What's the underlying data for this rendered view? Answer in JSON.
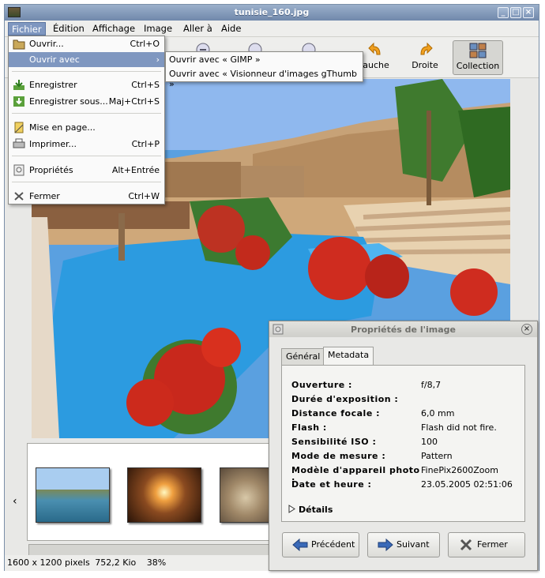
{
  "window": {
    "title": "tunisie_160.jpg",
    "buttons": [
      "_",
      "□",
      "×"
    ]
  },
  "menubar": [
    "Fichier",
    "Édition",
    "Affichage",
    "Image",
    "Aller à",
    "Aide"
  ],
  "toolbar": {
    "gauche": "auche",
    "droite": "Droite",
    "collection": "Collection"
  },
  "file_menu": {
    "open": {
      "label": "Ouvrir...",
      "accel": "Ctrl+O"
    },
    "open_with": {
      "label": "Ouvrir avec",
      "arrow": "›"
    },
    "save": {
      "label": "Enregistrer",
      "accel": "Ctrl+S"
    },
    "save_as": {
      "label": "Enregistrer sous...",
      "accel": "Maj+Ctrl+S"
    },
    "page_setup": {
      "label": "Mise en page...",
      "accel": ""
    },
    "print": {
      "label": "Imprimer...",
      "accel": "Ctrl+P"
    },
    "properties": {
      "label": "Propriétés",
      "accel": "Alt+Entrée"
    },
    "close": {
      "label": "Fermer",
      "accel": "Ctrl+W"
    }
  },
  "open_with_submenu": [
    "Ouvrir avec « GIMP »",
    "Ouvrir avec « Visionneur d'images gThumb »"
  ],
  "status": {
    "size": "1600 x 1200 pixels",
    "filesize": "752,2 Kio",
    "zoom": "38%"
  },
  "thumb_nav": {
    "left_arrow": "‹"
  },
  "dialog": {
    "title": "Propriétés de l'image",
    "tabs": [
      "Général",
      "Metadata"
    ],
    "rows": [
      {
        "key": "Ouverture :",
        "value": "f/8,7"
      },
      {
        "key": "Durée d'exposition :",
        "value": ""
      },
      {
        "key": "Distance focale :",
        "value": "6,0 mm"
      },
      {
        "key": "Flash :",
        "value": "Flash did not fire."
      },
      {
        "key": "Sensibilité ISO :",
        "value": "100"
      },
      {
        "key": "Mode de mesure :",
        "value": "Pattern"
      },
      {
        "key": "Modèle d'appareil photo :",
        "value": "FinePix2600Zoom"
      },
      {
        "key": "Date et heure :",
        "value": "23.05.2005 02:51:06"
      }
    ],
    "details": "Détails",
    "buttons": {
      "prev": "Précédent",
      "next": "Suivant",
      "close": "Fermer"
    }
  }
}
